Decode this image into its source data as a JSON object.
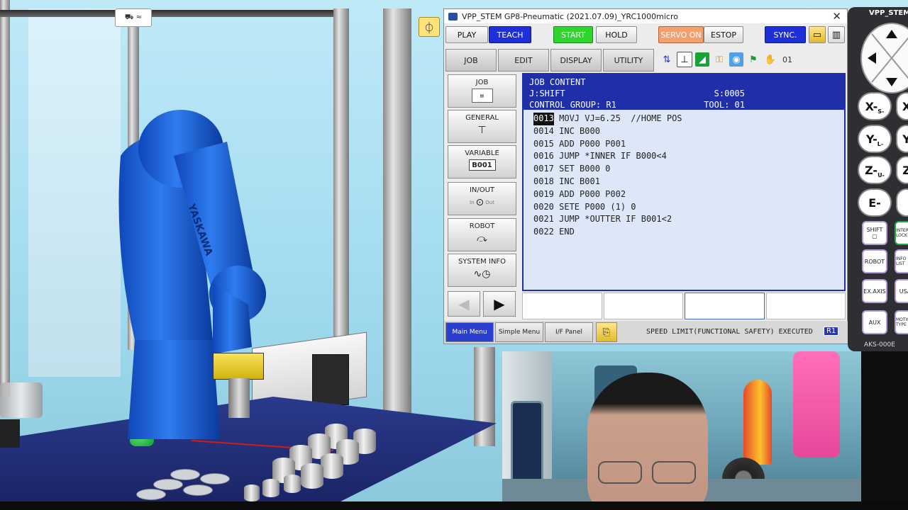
{
  "pendant": {
    "title": "VPP_STEM GP8-Pneumatic (2021.07.09)_YRC1000micro",
    "close_glyph": "✕",
    "top_buttons": {
      "play": "PLAY",
      "teach": "TEACH",
      "start": "START",
      "hold": "HOLD",
      "servo_on": "SERVO ON",
      "estop": "ESTOP",
      "sync": "SYNC."
    },
    "menu": {
      "job": "JOB",
      "edit": "EDIT",
      "display": "DISPLAY",
      "utility": "UTILITY"
    },
    "side_menu": {
      "job": "JOB",
      "general": "GENERAL",
      "variable": "VARIABLE",
      "variable_badge": "B001",
      "in_out": "IN/OUT",
      "in_label": "In",
      "out_label": "Out",
      "robot": "ROBOT",
      "system_info": "SYSTEM INFO"
    },
    "job": {
      "heading": "JOB CONTENT",
      "job_name": "J:SHIFT",
      "step": "S:0005",
      "control_group": "CONTROL GROUP: R1",
      "tool": "TOOL: 01",
      "lines": [
        {
          "num": "0013",
          "text": " MOVJ VJ=6.25  //HOME POS"
        },
        {
          "num": "0014",
          "text": " INC B000"
        },
        {
          "num": "0015",
          "text": " ADD P000 P001"
        },
        {
          "num": "0016",
          "text": " JUMP *INNER IF B000<4"
        },
        {
          "num": "0017",
          "text": " SET B000 0"
        },
        {
          "num": "0018",
          "text": " INC B001"
        },
        {
          "num": "0019",
          "text": " ADD P000 P002"
        },
        {
          "num": "0020",
          "text": " SETE P000 (1) 0"
        },
        {
          "num": "0021",
          "text": " JUMP *OUTTER IF B001<2"
        },
        {
          "num": "0022",
          "text": " END"
        }
      ]
    },
    "bottom": {
      "main_menu": "Main Menu",
      "simple_menu": "Simple Menu",
      "if_panel": "I/F Panel",
      "status_message": "SPEED LIMIT(FUNCTIONAL SAFETY) EXECUTED",
      "group_badge": "R1"
    },
    "colors": {
      "teach": "#1f2fd8",
      "start": "#2fd42f",
      "servo_on": "#f3a070",
      "sync": "#1f2fd8",
      "job_header": "#1f2fa8"
    }
  },
  "keypad": {
    "title": "VPP_STEM",
    "axis_keys": [
      {
        "main": "X-",
        "sub": "S-"
      },
      {
        "main": "Y-",
        "sub": "L-"
      },
      {
        "main": "Z-",
        "sub": "U-"
      },
      {
        "main": "E-",
        "sub": ""
      }
    ],
    "axis_keys_right": [
      "X",
      "Y",
      "Z",
      ""
    ],
    "small_keys": [
      "SHIFT",
      "ROBOT",
      "EX.AXIS",
      "AUX"
    ],
    "small_keys_right": [
      "INTER LOCK",
      "INFO LIST",
      "USA",
      "MOTION TYPE"
    ],
    "model": "AKS-000E"
  },
  "scene": {
    "robot_brand": "YASKAWA",
    "top_icon": "⛟ ≈",
    "corner_icon": "⏀"
  }
}
